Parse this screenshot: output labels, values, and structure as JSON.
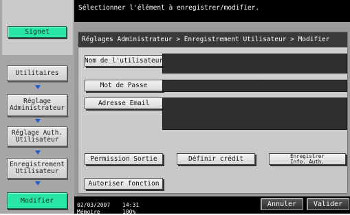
{
  "header": {
    "instruction": "Sélectionner l'élément à enregistrer/modifier."
  },
  "sidebar": {
    "signet_label": "Signet",
    "items": [
      {
        "label": "Utilitaires"
      },
      {
        "label_line1": "Réglage",
        "label_line2": "Administrateur"
      },
      {
        "label_line1": "Réglage Auth.",
        "label_line2": "Utilisateur"
      },
      {
        "label_line1": "Enregistrement",
        "label_line2": "Utilisateur"
      }
    ],
    "current_label": "Modifier"
  },
  "breadcrumb": {
    "text": "Réglages Administrateur > Enregistrement Utilisateur > Modifier"
  },
  "form": {
    "username_label": "Nom de l'utilisateur",
    "username_value": "",
    "password_label": "Mot de Passe",
    "password_value": "",
    "email_label": "Adresse Email",
    "email_value": ""
  },
  "actions": {
    "permission_label": "Permission Sortie",
    "credit_label": "Définir crédit",
    "auth_info_line1": "Enregistrer",
    "auth_info_line2": "Info. Auth.",
    "authorize_label": "Autoriser fonction"
  },
  "status": {
    "date": "02/03/2007",
    "time": "14:31",
    "memory_label": "Mémoire",
    "memory_value": "100%"
  },
  "footer": {
    "cancel_label": "Annuler",
    "validate_label": "Valider"
  }
}
